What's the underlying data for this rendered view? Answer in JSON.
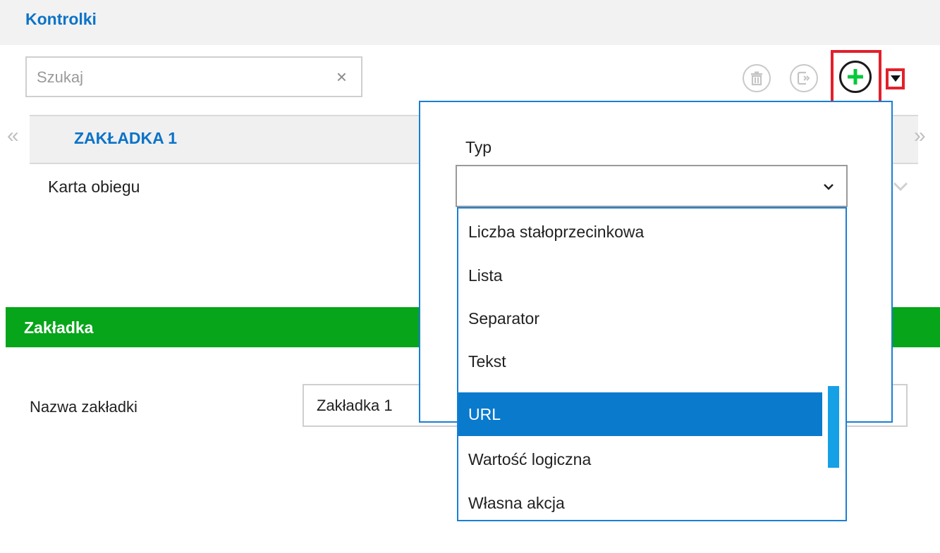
{
  "section": {
    "title": "Kontrolki"
  },
  "search": {
    "placeholder": "Szukaj",
    "value": "",
    "clear_glyph": "×"
  },
  "toolbar": {
    "delete_icon": "trash-icon",
    "export_icon": "export-icon",
    "add_icon": "plus-icon",
    "menu_icon": "dropdown-arrow-icon",
    "add_color": "#06c93c",
    "highlight_color": "#e3202a"
  },
  "tabs": {
    "prev_glyph": "«",
    "next_glyph": "»",
    "items": [
      {
        "label": "ZAKŁADKA 1"
      }
    ]
  },
  "card": {
    "label": "Karta obiegu"
  },
  "panel": {
    "title": "Zakładka",
    "color": "#06a51a",
    "field_label": "Nazwa zakładki",
    "field_value": "Zakładka 1"
  },
  "popup": {
    "typ_label": "Typ",
    "select_value": "",
    "options": [
      {
        "label": "Liczba stałoprzecinkowa",
        "selected": false
      },
      {
        "label": "Lista",
        "selected": false
      },
      {
        "label": "Separator",
        "selected": false
      },
      {
        "label": "Tekst",
        "selected": false
      },
      {
        "label": "URL",
        "selected": true
      },
      {
        "label": "Wartość logiczna",
        "selected": false
      },
      {
        "label": "Własna akcja",
        "selected": false
      }
    ],
    "accent": "#0a7acd"
  }
}
